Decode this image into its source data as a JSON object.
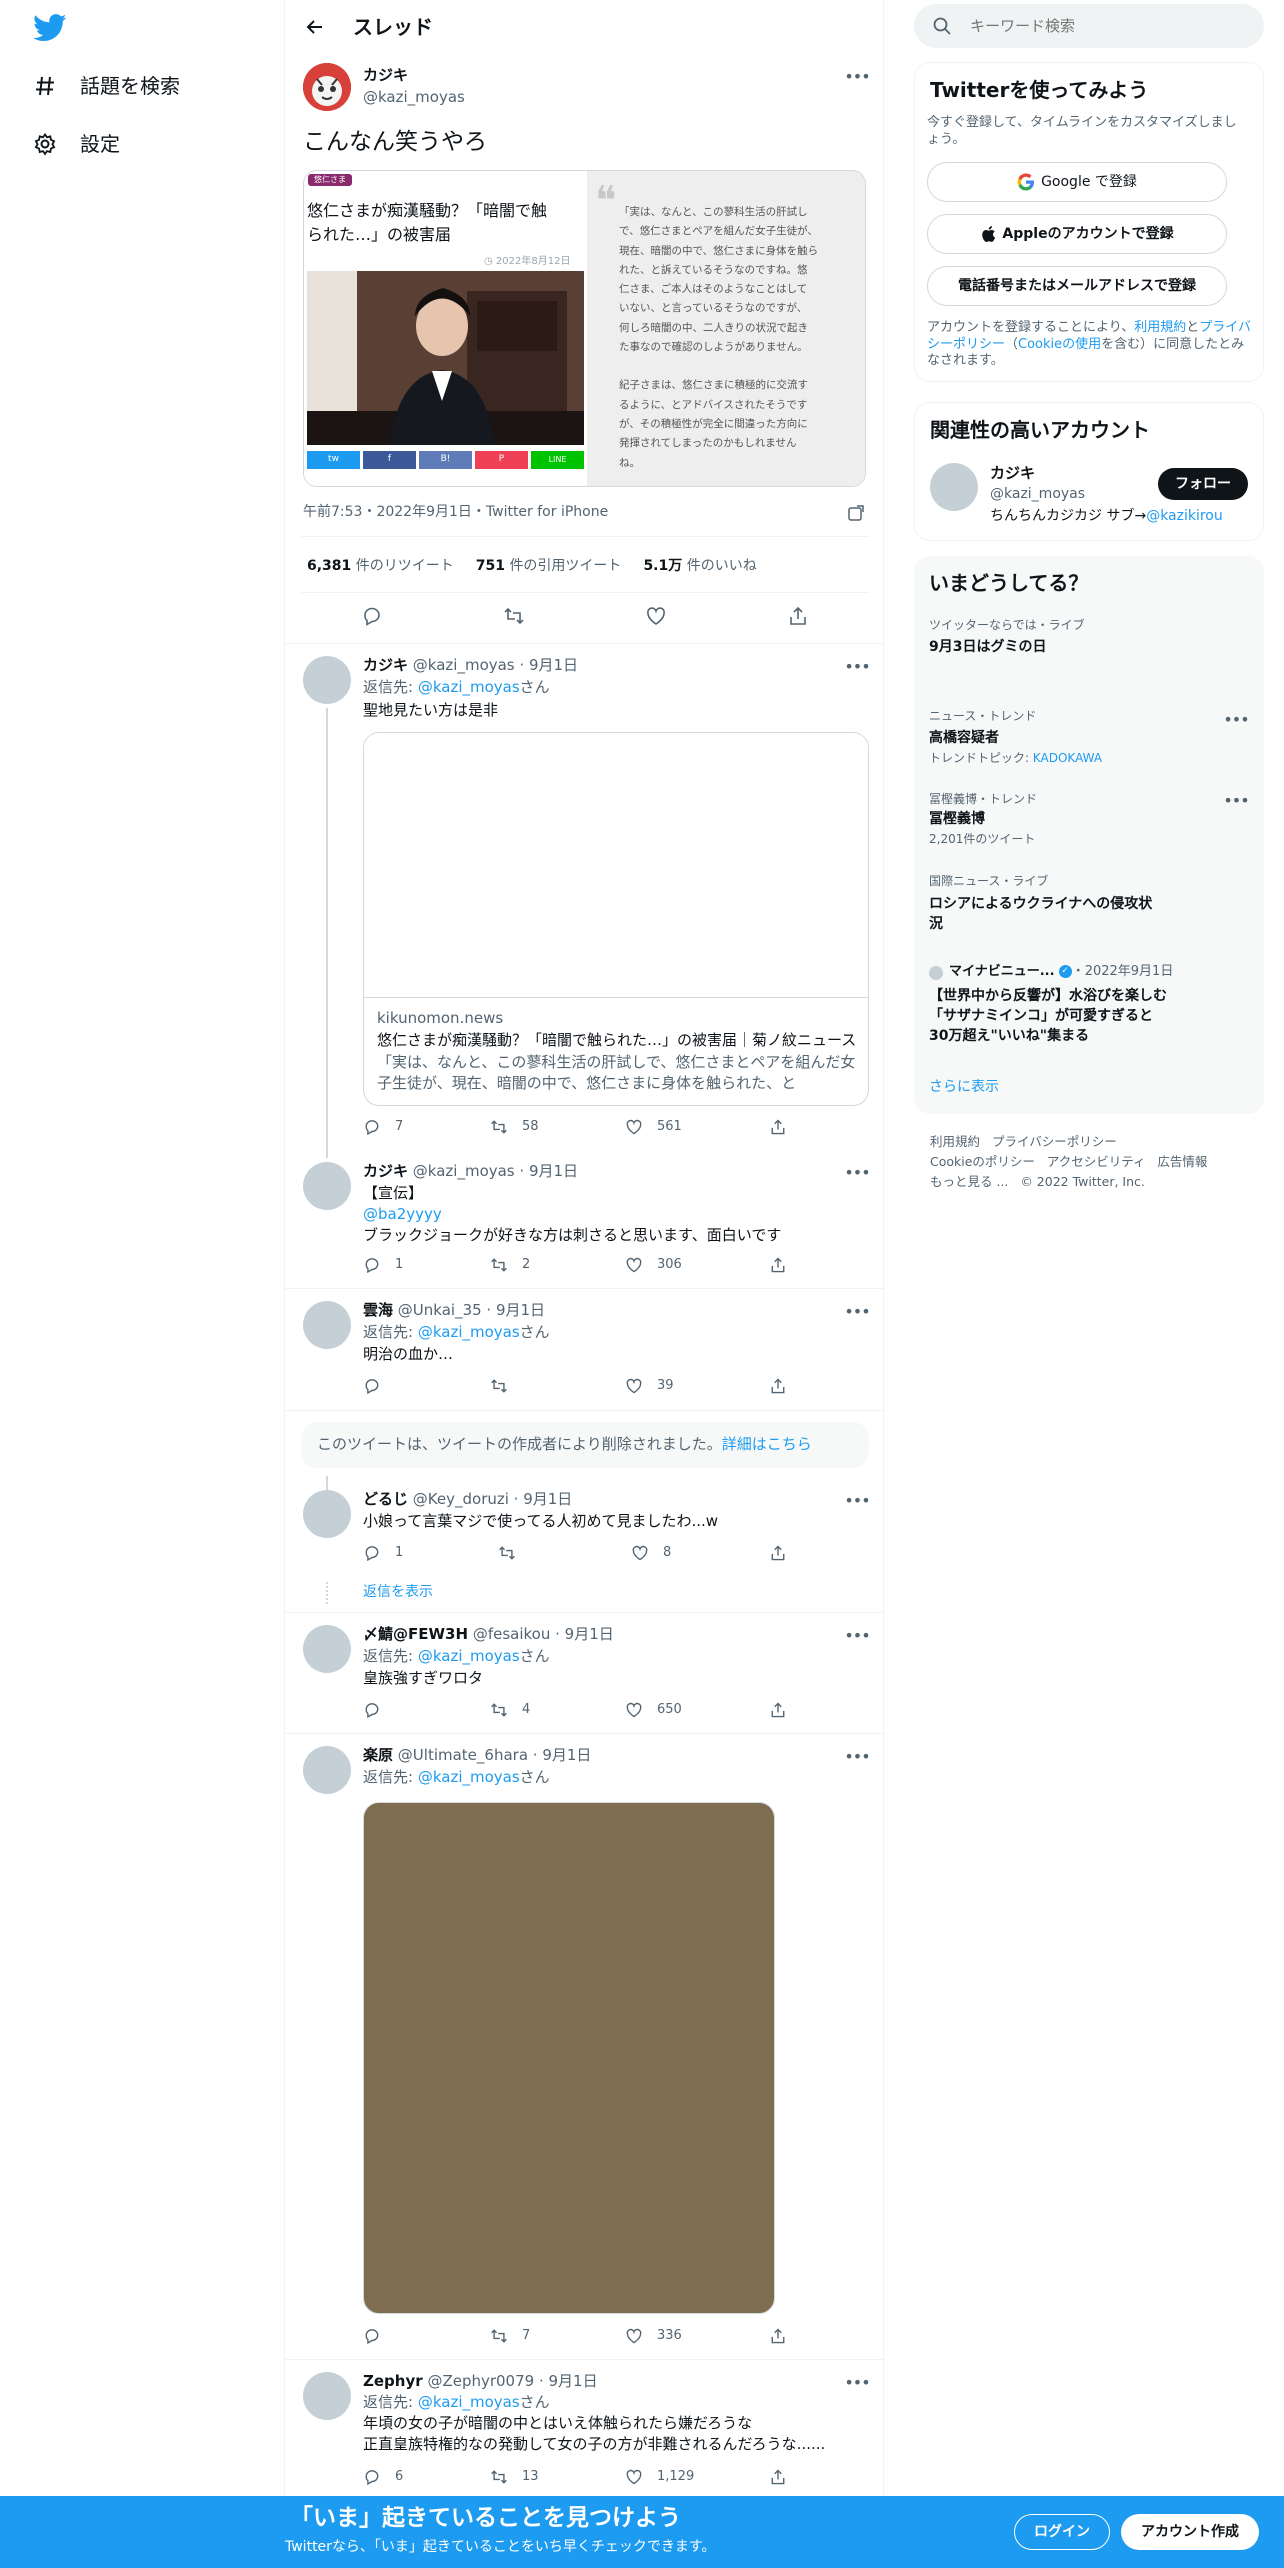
{
  "nav": {
    "explore": "話題を検索",
    "settings": "設定"
  },
  "header": {
    "title": "スレッド"
  },
  "main_tweet": {
    "name": "カジキ",
    "handle": "@kazi_moyas",
    "text": "こんなん笑うやろ",
    "article": {
      "tag": "悠仁さま",
      "title_line1": "悠仁さまが痴漢騒動？「暗闇で触",
      "title_line2": "られた…」の被害届",
      "date": "2022年8月12日",
      "quote_lines": [
        "「実は、なんと、この蓼科生活の肝試し",
        "で、悠仁さまとペアを組んだ女子生徒が、",
        "現在、暗闇の中で、悠仁さまに身体を触ら",
        "れた、と訴えているそうなのですね。悠",
        "仁さま、ご本人はそのようなことはして",
        "いない、と言っているそうなのですが、",
        "何しろ暗闇の中、二人きりの状況で起き",
        "た事なので確認のしようがありません。",
        "",
        "紀子さまは、悠仁さまに積極的に交流す",
        "るように、とアドバイスされたそうです",
        "が、その積極性が完全に間違った方向に",
        "発揮されてしまったのかもしれません",
        "ね。"
      ],
      "share": [
        "tw",
        "f",
        "B!",
        "P",
        "LINE"
      ]
    },
    "meta": "午前7:53・2022年9月1日・Twitter for iPhone",
    "stats": [
      {
        "num": "6,381",
        "label": "件のリツイート"
      },
      {
        "num": "751",
        "label": "件の引用ツイート"
      },
      {
        "num": "5.1万",
        "label": "件のいいね"
      }
    ]
  },
  "replies": [
    {
      "name": "カジキ",
      "handle": "@kazi_moyas",
      "date": "9月1日",
      "reply_prefix": "返信先: ",
      "reply_to": "@kazi_moyas",
      "reply_suffix": "さん",
      "text": "聖地見たい方は是非",
      "card": {
        "domain": "kikunomon.news",
        "title": "悠仁さまが痴漢騒動？「暗闇で触られた…」の被害届｜菊ノ紋ニュース",
        "desc1": "「実は、なんと、この蓼科生活の肝試しで、悠仁さまとペアを組んだ女",
        "desc2": "子生徒が、現在、暗闇の中で、悠仁さまに身体を触られた、と"
      },
      "counts": {
        "reply": "7",
        "rt": "58",
        "like": "561"
      }
    },
    {
      "name": "カジキ",
      "handle": "@kazi_moyas",
      "date": "9月1日",
      "line1": "【宣伝】",
      "mention": "@ba2yyyy",
      "line2": "ブラックジョークが好きな方は刺さると思います、面白いです",
      "counts": {
        "reply": "1",
        "rt": "2",
        "like": "306"
      }
    },
    {
      "name": "雲海",
      "handle": "@Unkai_35",
      "date": "9月1日",
      "reply_prefix": "返信先: ",
      "reply_to": "@kazi_moyas",
      "reply_suffix": "さん",
      "text": "明治の血か…",
      "counts": {
        "reply": "",
        "rt": "",
        "like": "39"
      }
    },
    {
      "deleted": "このツイートは、ツイートの作成者により削除されました。",
      "deleted_link": "詳細はこちら"
    },
    {
      "name": "どるじ",
      "handle": "@Key_doruzi",
      "date": "9月1日",
      "text": "小娘って言葉マジで使ってる人初めて見ましたわ...w",
      "counts": {
        "reply": "1",
        "rt": "",
        "like": "8"
      },
      "show_replies": "返信を表示"
    },
    {
      "name": "〆鯖@FEW3H",
      "handle": "@fesaikou",
      "date": "9月1日",
      "reply_prefix": "返信先: ",
      "reply_to": "@kazi_moyas",
      "reply_suffix": "さん",
      "text": "皇族強すぎワロタ",
      "counts": {
        "reply": "",
        "rt": "4",
        "like": "650"
      }
    },
    {
      "name": "楽原",
      "handle": "@Ultimate_6hara",
      "date": "9月1日",
      "reply_prefix": "返信先: ",
      "reply_to": "@kazi_moyas",
      "reply_suffix": "さん",
      "counts": {
        "reply": "",
        "rt": "7",
        "like": "336"
      }
    },
    {
      "name": "Zephyr",
      "handle": "@Zephyr0079",
      "date": "9月1日",
      "reply_prefix": "返信先: ",
      "reply_to": "@kazi_moyas",
      "reply_suffix": "さん",
      "line1": "年頃の女の子が暗闇の中とはいえ体触られたら嫌だろうな",
      "line2": "正直皇族特権的なの発動して女の子の方が非難されるんだろうな......",
      "counts": {
        "reply": "6",
        "rt": "13",
        "like": "1,129"
      }
    }
  ],
  "sidebar": {
    "search_placeholder": "キーワード検索",
    "signup": {
      "title": "Twitterを使ってみよう",
      "sub": "今すぐ登録して、タイムラインをカスタマイズしましょう。",
      "google": "Google で登録",
      "apple": "Appleのアカウントで登録",
      "phone": "電話番号またはメールアドレスで登録",
      "legal_a": "アカウントを登録することにより、",
      "legal_b": "利用規約",
      "legal_c": "と",
      "legal_d": "プライバシーポリシー",
      "legal_e": "（",
      "legal_f": "Cookieの使用",
      "legal_g": "を含む）に同意したとみなされます。"
    },
    "related": {
      "title": "関連性の高いアカウント",
      "name": "カジキ",
      "handle": "@kazi_moyas",
      "follow": "フォロー",
      "bio_a": "ちんちんカジカジ サブ→",
      "bio_b": "@kazikirou"
    },
    "trends": {
      "title": "いまどうしてる？",
      "items": [
        {
          "cat": "ツイッターならでは・ライブ",
          "name": "9月3日はグミの日",
          "extra": ""
        },
        {
          "cat": "ニュース・トレンド",
          "name": "高橋容疑者",
          "extra_a": "トレンドトピック: ",
          "extra_b": "KADOKAWA"
        },
        {
          "cat": "冨樫義博・トレンド",
          "name": "冨樫義博",
          "extra": "2,201件のツイート"
        },
        {
          "cat": "国際ニュース・ライブ",
          "name": "ロシアによるウクライナへの侵攻状況",
          "extra": ""
        }
      ],
      "news": {
        "source": "マイナビニュー...",
        "date": "・2022年9月1日",
        "title": "【世界中から反響が】水浴びを楽しむ「サザナミインコ」が可愛すぎると30万超え\"いいね\"集まる"
      },
      "more": "さらに表示"
    },
    "footer": {
      "l1a": "利用規約",
      "l1b": "プライバシーポリシー",
      "l2a": "Cookieのポリシー",
      "l2b": "アクセシビリティ",
      "l2c": "広告情報",
      "l3a": "もっと見る ...",
      "l3b": "© 2022 Twitter, Inc."
    }
  },
  "bottom": {
    "title": "「いま」起きていることを見つけよう",
    "sub": "Twitterなら、「いま」起きていることをいち早くチェックできます。",
    "login": "ログイン",
    "signup": "アカウント作成"
  },
  "colors": {
    "brand": "#1d9bf0",
    "text": "#0f1419",
    "muted": "#536471",
    "media_placeholder": "#7f6d4f"
  }
}
